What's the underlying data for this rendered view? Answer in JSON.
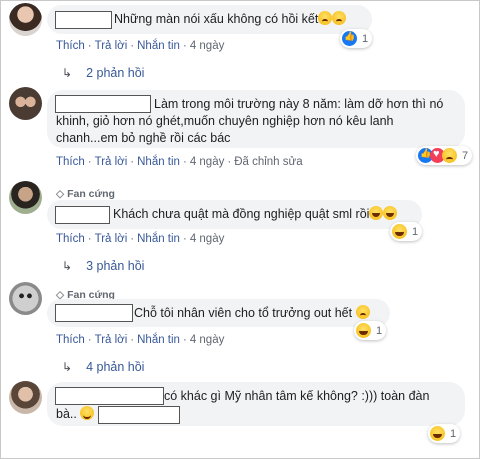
{
  "actions": {
    "like": "Thích",
    "reply": "Trả lời",
    "message": "Nhắn tin",
    "edited": "Đã chỉnh sửa"
  },
  "comments": [
    {
      "text": "Những màn nói xấu không có hồi kết",
      "time": "4 ngày",
      "reaction_count": "1",
      "replies": "2 phản hồi"
    },
    {
      "text": "Làm trong môi trường này 8 năm: làm dỡ hơn thì nó khinh, giỏ hơn nó ghét,muốn chuyên nghiệp hơn nó kêu lanh chanh...em bỏ nghề rồi các bác",
      "time": "4 ngày",
      "reaction_count": "7"
    },
    {
      "badge": "Fan cứng",
      "text": "Khách chưa quật mà đồng nghiệp quật sml rồi",
      "time": "4 ngày",
      "reaction_count": "1",
      "replies": "3 phản hồi"
    },
    {
      "badge": "Fan cứng",
      "text": "Chỗ tôi nhân viên cho tổ trưởng out hết",
      "time": "4 ngày",
      "reaction_count": "1",
      "replies": "4 phản hồi"
    },
    {
      "text": "có khác gì Mỹ nhân tâm kế không? :))) toàn đàn",
      "text2": "bà..",
      "reaction_count": "1"
    }
  ],
  "colors": {
    "link": "#385898",
    "bubble": "#f2f3f5",
    "meta": "#606770"
  }
}
